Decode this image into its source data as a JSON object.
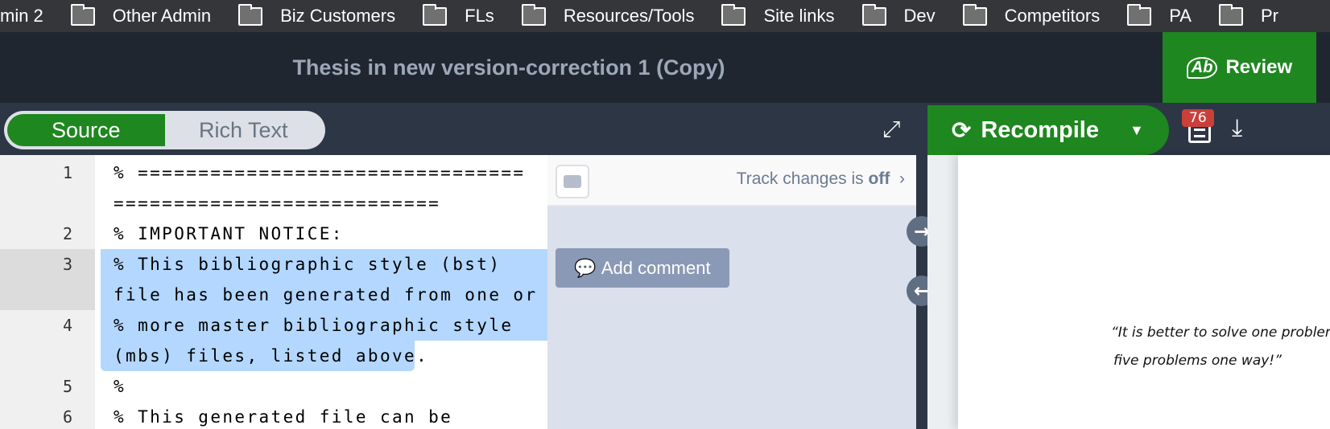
{
  "bookmarks": [
    "min 2",
    "Other Admin",
    "Biz Customers",
    "FLs",
    "Resources/Tools",
    "Site links",
    "Dev",
    "Competitors",
    "PA",
    "Pr"
  ],
  "header": {
    "title": "Thesis in new version-correction 1 (Copy)",
    "review_label": "Review"
  },
  "toolbar": {
    "source_label": "Source",
    "richtext_label": "Rich Text",
    "recompile_label": "Recompile",
    "logs_badge": "76"
  },
  "editor": {
    "lines": [
      {
        "number": "1",
        "rows": [
          "% ================================",
          "==========================="
        ]
      },
      {
        "number": "2",
        "rows": [
          "% IMPORTANT NOTICE:"
        ]
      },
      {
        "number": "3",
        "rows": [
          "% This bibliographic style (bst)",
          "file has been generated from one or"
        ],
        "active": true
      },
      {
        "number": "4",
        "rows": [
          "% more master bibliographic style",
          "(mbs) files, listed above."
        ]
      },
      {
        "number": "5",
        "rows": [
          "%"
        ]
      },
      {
        "number": "6",
        "rows": [
          "% This generated file can be"
        ]
      }
    ]
  },
  "review_panel": {
    "track_text": "Track changes is ",
    "track_state": "off",
    "add_comment": "Add comment"
  },
  "pdf": {
    "quote_line1": "“It is better to solve one problem",
    "quote_line2": "five problems one way!”"
  },
  "colors": {
    "accent": "#1e871f",
    "selection": "#b3d7fe",
    "badge": "#c9403b"
  }
}
